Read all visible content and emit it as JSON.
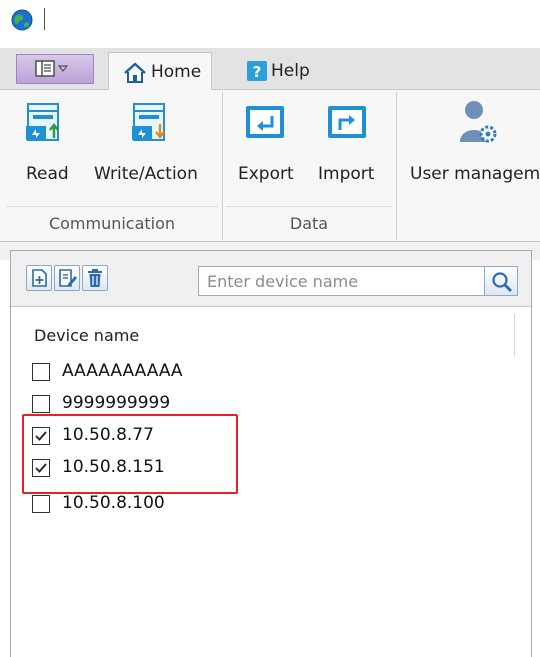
{
  "ribbon_tabs": {
    "home": "Home",
    "help": "Help"
  },
  "ribbon": {
    "communication": {
      "group_label": "Communication",
      "read": "Read",
      "write_action": "Write/Action"
    },
    "data": {
      "group_label": "Data",
      "export": "Export",
      "import": "Import"
    },
    "user_management": "User managem"
  },
  "device_panel": {
    "search_placeholder": "Enter device name",
    "column_header": "Device name",
    "devices": [
      {
        "name": "AAAAAAAAAA",
        "checked": false
      },
      {
        "name": "9999999999",
        "checked": false
      },
      {
        "name": "10.50.8.77",
        "checked": true
      },
      {
        "name": "10.50.8.151",
        "checked": true
      },
      {
        "name": "10.50.8.100",
        "checked": false
      }
    ]
  },
  "colors": {
    "accent_blue": "#1f8fd6",
    "highlight_red": "#e8202a",
    "quick_menu_purple": "#c7b3e2"
  }
}
